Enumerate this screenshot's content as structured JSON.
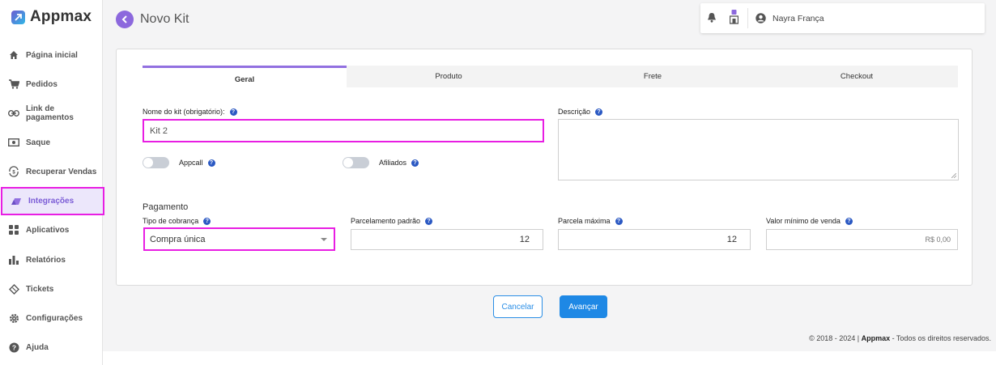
{
  "brand": {
    "name": "Appmax"
  },
  "sidebar": {
    "items": [
      {
        "label": "Página inicial",
        "icon": "home-icon"
      },
      {
        "label": "Pedidos",
        "icon": "cart-icon"
      },
      {
        "label": "Link de pagamentos",
        "icon": "link-icon"
      },
      {
        "label": "Saque",
        "icon": "cash-icon"
      },
      {
        "label": "Recuperar Vendas",
        "icon": "recover-icon"
      },
      {
        "label": "Integrações",
        "icon": "integrations-icon",
        "active": true
      },
      {
        "label": "Aplicativos",
        "icon": "apps-grid-icon"
      },
      {
        "label": "Relatórios",
        "icon": "bar-chart-icon"
      },
      {
        "label": "Tickets",
        "icon": "ticket-icon"
      },
      {
        "label": "Configurações",
        "icon": "gear-icon"
      },
      {
        "label": "Ajuda",
        "icon": "help-circle-icon"
      }
    ]
  },
  "header": {
    "title": "Novo Kit",
    "user_name": "Nayra França"
  },
  "tabs": [
    {
      "label": "Geral",
      "active": true
    },
    {
      "label": "Produto"
    },
    {
      "label": "Frete"
    },
    {
      "label": "Checkout"
    }
  ],
  "form": {
    "kit_name_label": "Nome do kit (obrigatório):",
    "kit_name_value": "Kit 2",
    "description_label": "Descrição",
    "description_value": "",
    "appcall_label": "Appcall",
    "afiliados_label": "Afiliados",
    "payment_section": "Pagamento",
    "billing_type_label": "Tipo de cobrança",
    "billing_type_value": "Compra única",
    "default_installments_label": "Parcelamento padrão",
    "default_installments_value": "12",
    "max_installment_label": "Parcela máxima",
    "max_installment_value": "12",
    "min_sale_label": "Valor mínimo de venda",
    "min_sale_placeholder": "R$ 0,00",
    "help_glyph": "?"
  },
  "actions": {
    "cancel": "Cancelar",
    "next": "Avançar"
  },
  "footer": {
    "prefix": "© 2018 - 2024 | ",
    "brand": "Appmax",
    "suffix": " - Todos os direitos reservados."
  },
  "colors": {
    "accent": "#8c68dd",
    "primary": "#1e88e5",
    "highlight": "#e81ee3"
  }
}
